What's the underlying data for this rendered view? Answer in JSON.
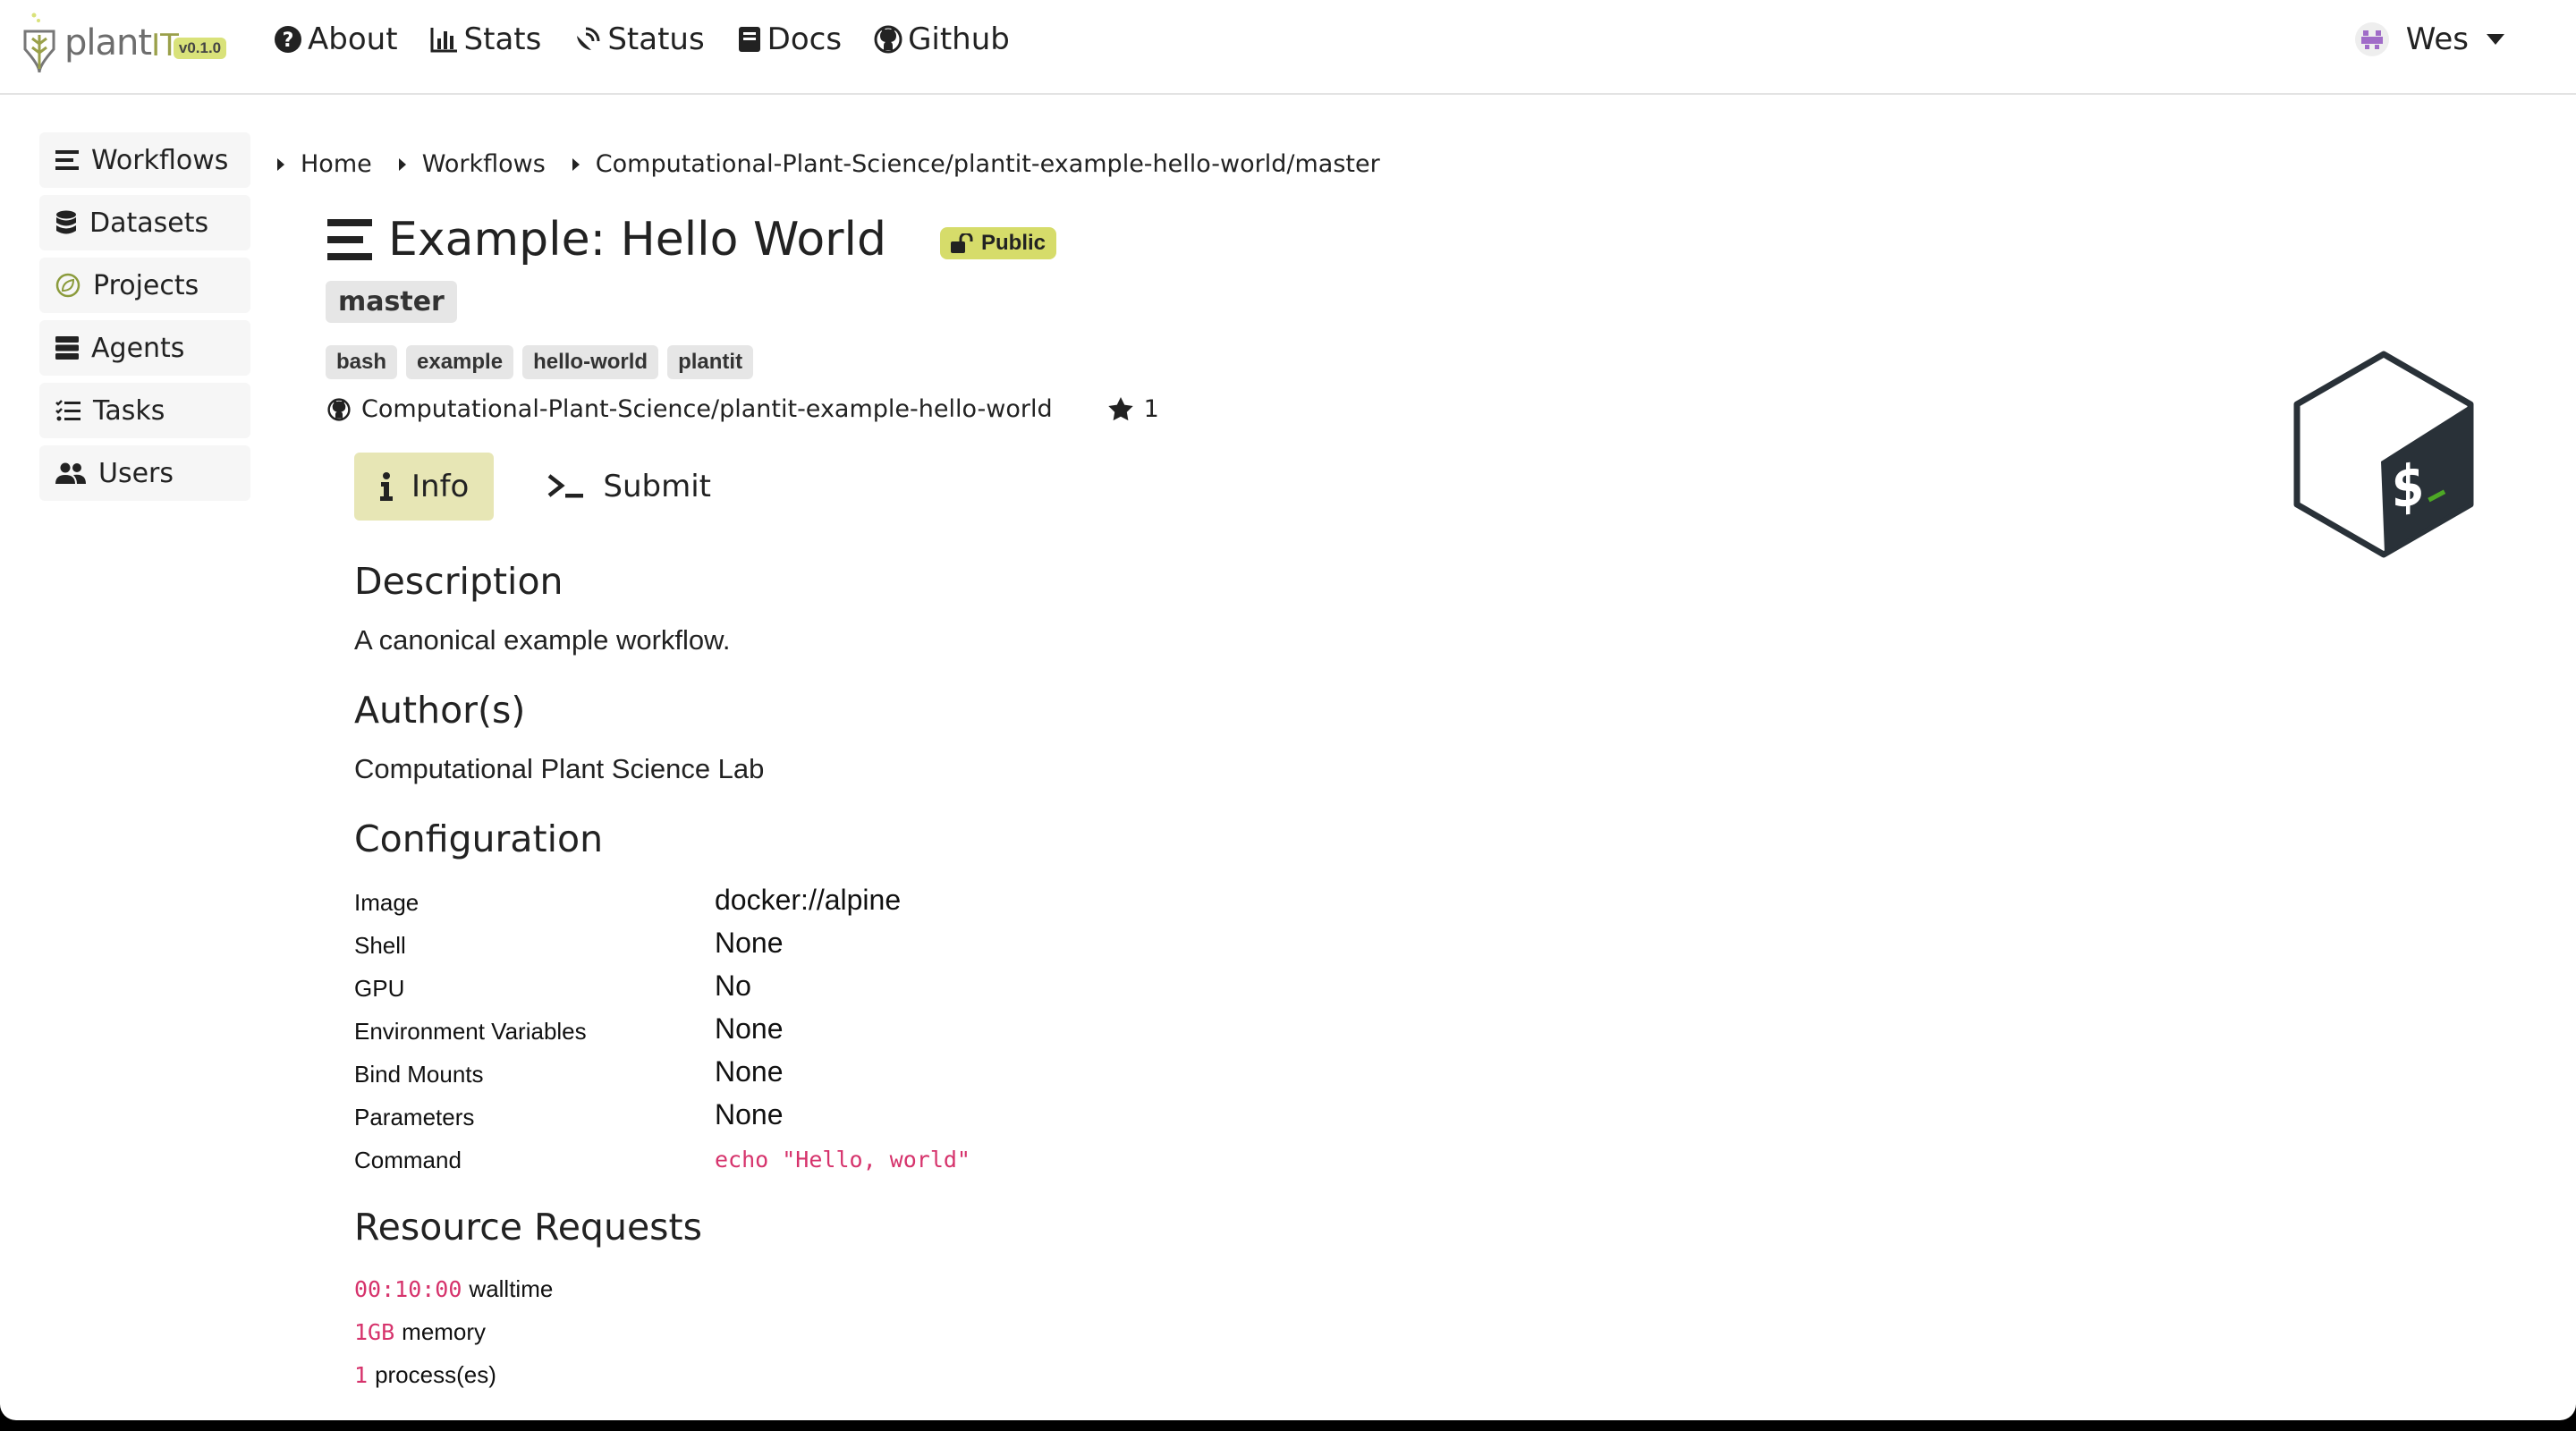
{
  "navbar": {
    "brand": "plant",
    "brand_suffix": "IT",
    "version": "v0.1.0",
    "links": [
      "About",
      "Stats",
      "Status",
      "Docs",
      "Github"
    ],
    "user_name": "Wes"
  },
  "sidebar": {
    "items": [
      {
        "label": "Workflows",
        "icon": "list-icon"
      },
      {
        "label": "Datasets",
        "icon": "database-icon"
      },
      {
        "label": "Projects",
        "icon": "leaf-icon"
      },
      {
        "label": "Agents",
        "icon": "server-icon"
      },
      {
        "label": "Tasks",
        "icon": "tasks-icon"
      },
      {
        "label": "Users",
        "icon": "users-icon"
      }
    ]
  },
  "breadcrumb": [
    "Home",
    "Workflows",
    "Computational-Plant-Science/plantit-example-hello-world/master"
  ],
  "workflow": {
    "title": "Example: Hello World",
    "visibility": "Public",
    "branch": "master",
    "tags": [
      "bash",
      "example",
      "hello-world",
      "plantit"
    ],
    "repo": "Computational-Plant-Science/plantit-example-hello-world",
    "stars": "1"
  },
  "tabs": {
    "info": "Info",
    "submit": "Submit"
  },
  "description": {
    "heading": "Description",
    "text": "A canonical example workflow."
  },
  "authors": {
    "heading": "Author(s)",
    "text": "Computational Plant Science Lab"
  },
  "configuration": {
    "heading": "Configuration",
    "rows": [
      {
        "label": "Image",
        "value": "docker://alpine"
      },
      {
        "label": "Shell",
        "value": "None"
      },
      {
        "label": "GPU",
        "value": "No"
      },
      {
        "label": "Environment Variables",
        "value": "None"
      },
      {
        "label": "Bind Mounts",
        "value": "None"
      },
      {
        "label": "Parameters",
        "value": "None"
      },
      {
        "label": "Command",
        "value": "echo \"Hello, world\""
      }
    ]
  },
  "resources": {
    "heading": "Resource Requests",
    "rows": [
      {
        "value": "00:10:00",
        "unit": "walltime"
      },
      {
        "value": "1GB",
        "unit": "memory"
      },
      {
        "value": "1",
        "unit": "process(es)"
      }
    ]
  },
  "colors": {
    "accent": "#d6dc6a",
    "active_tab": "#e7e6b5",
    "code": "#d6336c"
  }
}
